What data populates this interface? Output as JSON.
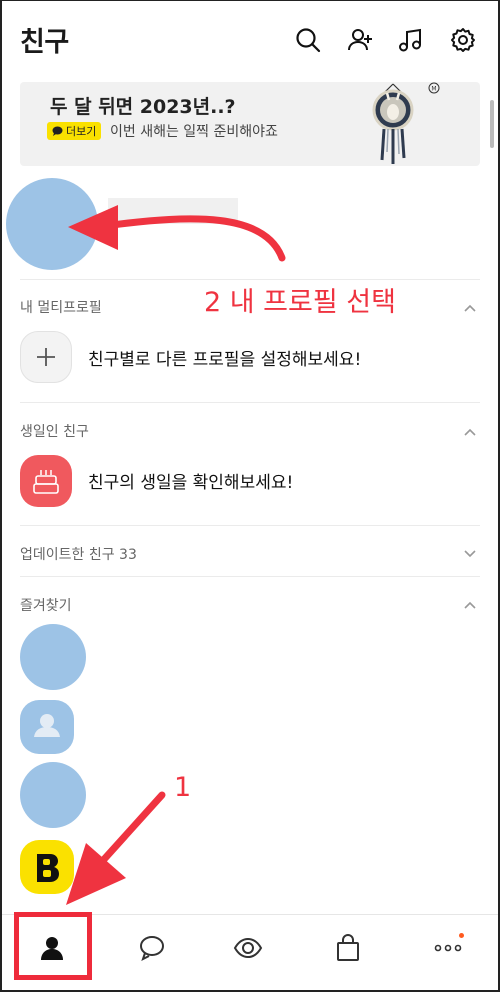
{
  "header": {
    "title": "친구",
    "icons": [
      "search-icon",
      "add-friend-icon",
      "music-icon",
      "settings-icon"
    ]
  },
  "banner": {
    "title": "두 달 뒤면 2023년..?",
    "pill_label": "더보기",
    "subtitle": "이번 새해는 일찍 준비해야죠",
    "badge": "M"
  },
  "multi_profile": {
    "section_label": "내 멀티프로필",
    "row_text": "친구별로 다른 프로필을 설정해보세요!"
  },
  "birthday": {
    "section_label": "생일인 친구",
    "row_text": "친구의 생일을 확인해보세요!"
  },
  "updated": {
    "section_label": "업데이트한 친구 33"
  },
  "favorites": {
    "section_label": "즐겨찾기",
    "items": [
      "avatar-photo",
      "default-profile-icon",
      "avatar-photo",
      "brand-b-logo"
    ]
  },
  "annotations": {
    "step1": "1",
    "step2": "2 내 프로필 선택"
  },
  "bottom_nav": [
    "friends-tab",
    "chats-tab",
    "view-tab",
    "shopping-tab",
    "more-tab"
  ],
  "colors": {
    "accent_yellow": "#fae100",
    "annotation_red": "#ef3340",
    "avatar_blue": "#9dc3e6",
    "birthday_red": "#f0595e"
  }
}
